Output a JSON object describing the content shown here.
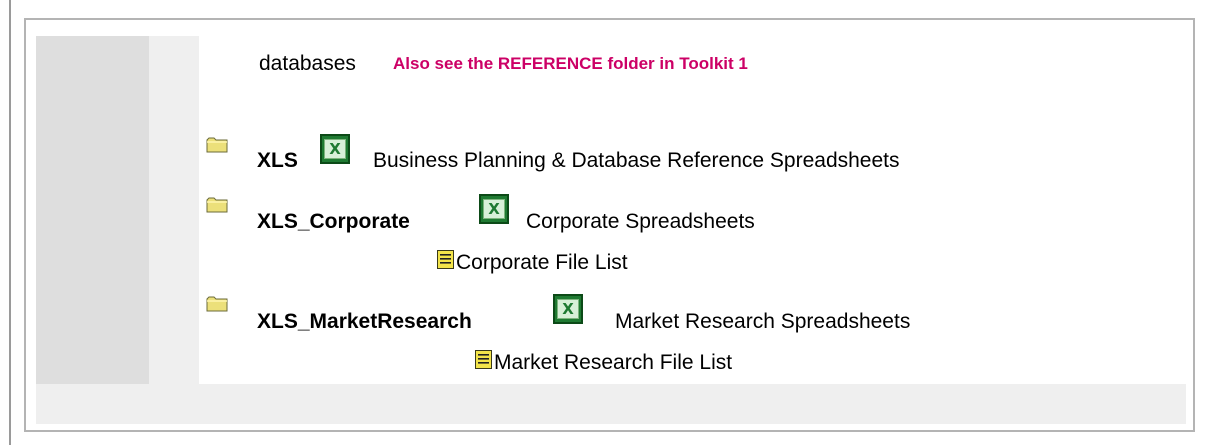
{
  "header": {
    "prefix": "databases",
    "note": "Also see the REFERENCE folder in Toolkit 1"
  },
  "items": [
    {
      "name": "XLS",
      "icon_folder": "folder-icon",
      "icon_app": "excel-icon",
      "description": "Business Planning & Database Reference Spreadsheets"
    },
    {
      "name": "XLS_Corporate",
      "icon_folder": "folder-icon",
      "icon_app": "excel-icon",
      "description": "Corporate Spreadsheets",
      "file_list": "Corporate File List",
      "file_list_icon": "document-icon"
    },
    {
      "name": "XLS_MarketResearch",
      "icon_folder": "folder-icon",
      "icon_app": "excel-icon",
      "description": "Market Research Spreadsheets",
      "file_list": "Market Research File List",
      "file_list_icon": "document-icon"
    }
  ],
  "colors": {
    "note": "#cc0066",
    "excel_green": "#1f7a32",
    "folder_yellow": "#ece07a",
    "sidebar_gray": "#dedede",
    "band_gray": "#efefef"
  }
}
